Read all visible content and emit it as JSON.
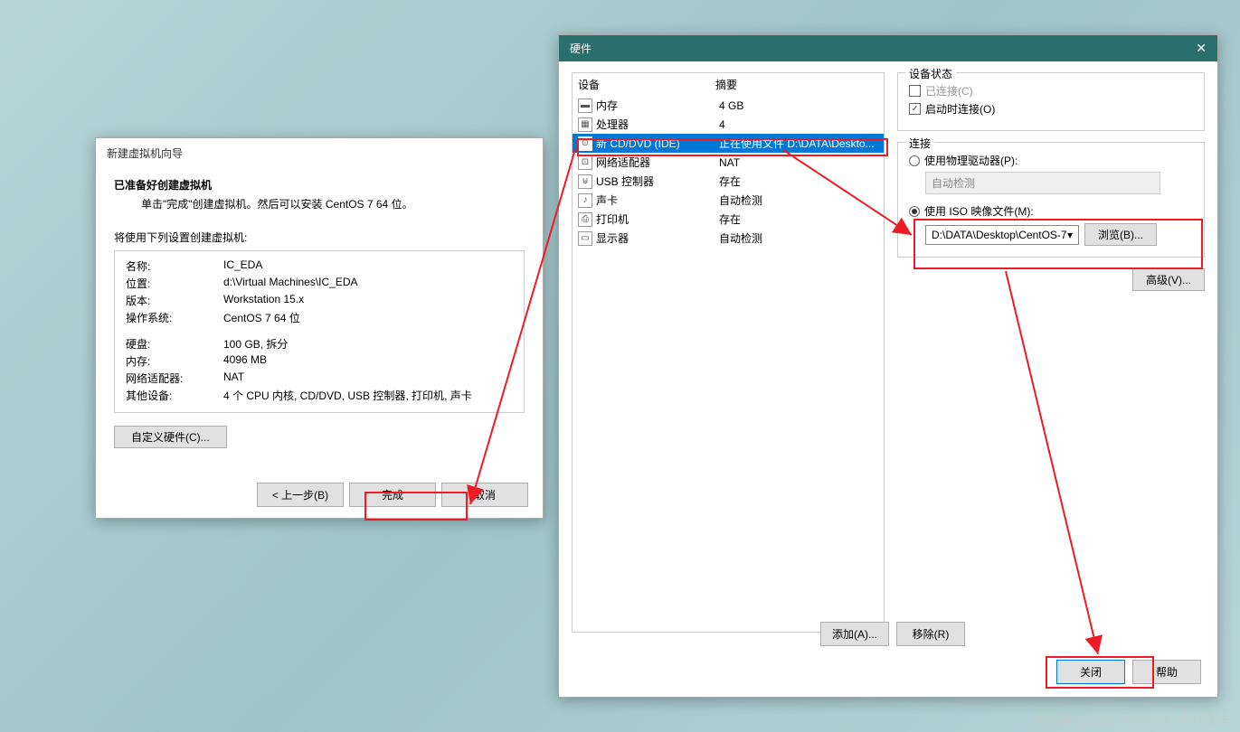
{
  "wizard": {
    "title": "新建虚拟机向导",
    "header_bold": "已准备好创建虚拟机",
    "header_sub": "单击\"完成\"创建虚拟机。然后可以安装 CentOS 7 64 位。",
    "note": "将使用下列设置创建虚拟机:",
    "fields": {
      "name_label": "名称:",
      "name_value": "IC_EDA",
      "location_label": "位置:",
      "location_value": "d:\\Virtual Machines\\IC_EDA",
      "version_label": "版本:",
      "version_value": "Workstation 15.x",
      "os_label": "操作系统:",
      "os_value": "CentOS 7 64 位",
      "disk_label": "硬盘:",
      "disk_value": "100 GB, 拆分",
      "memory_label": "内存:",
      "memory_value": "4096 MB",
      "net_label": "网络适配器:",
      "net_value": "NAT",
      "other_label": "其他设备:",
      "other_value": "4 个 CPU 内核, CD/DVD, USB 控制器, 打印机, 声卡"
    },
    "custom_hw_btn": "自定义硬件(C)...",
    "back_btn": "< 上一步(B)",
    "finish_btn": "完成",
    "cancel_btn": "取消"
  },
  "hw": {
    "title": "硬件",
    "col_device": "设备",
    "col_summary": "摘要",
    "devices": [
      {
        "name": "内存",
        "summary": "4 GB"
      },
      {
        "name": "处理器",
        "summary": "4"
      },
      {
        "name": "新 CD/DVD (IDE)",
        "summary": "正在使用文件 D:\\DATA\\Deskto..."
      },
      {
        "name": "网络适配器",
        "summary": "NAT"
      },
      {
        "name": "USB 控制器",
        "summary": "存在"
      },
      {
        "name": "声卡",
        "summary": "自动检测"
      },
      {
        "name": "打印机",
        "summary": "存在"
      },
      {
        "name": "显示器",
        "summary": "自动检测"
      }
    ],
    "status": {
      "legend": "设备状态",
      "connected": "已连接(C)",
      "connect_on": "启动时连接(O)"
    },
    "connection": {
      "legend": "连接",
      "use_physical": "使用物理驱动器(P):",
      "auto_detect": "自动检测",
      "use_iso": "使用 ISO 映像文件(M):",
      "iso_path": "D:\\DATA\\Desktop\\CentOS-7",
      "browse": "浏览(B)..."
    },
    "advanced": "高级(V)...",
    "add_btn": "添加(A)...",
    "remove_btn": "移除(R)",
    "close_btn": "关闭",
    "help_btn": "帮助"
  },
  "watermark": "https://blog.csdn.net/weixin_40377195"
}
